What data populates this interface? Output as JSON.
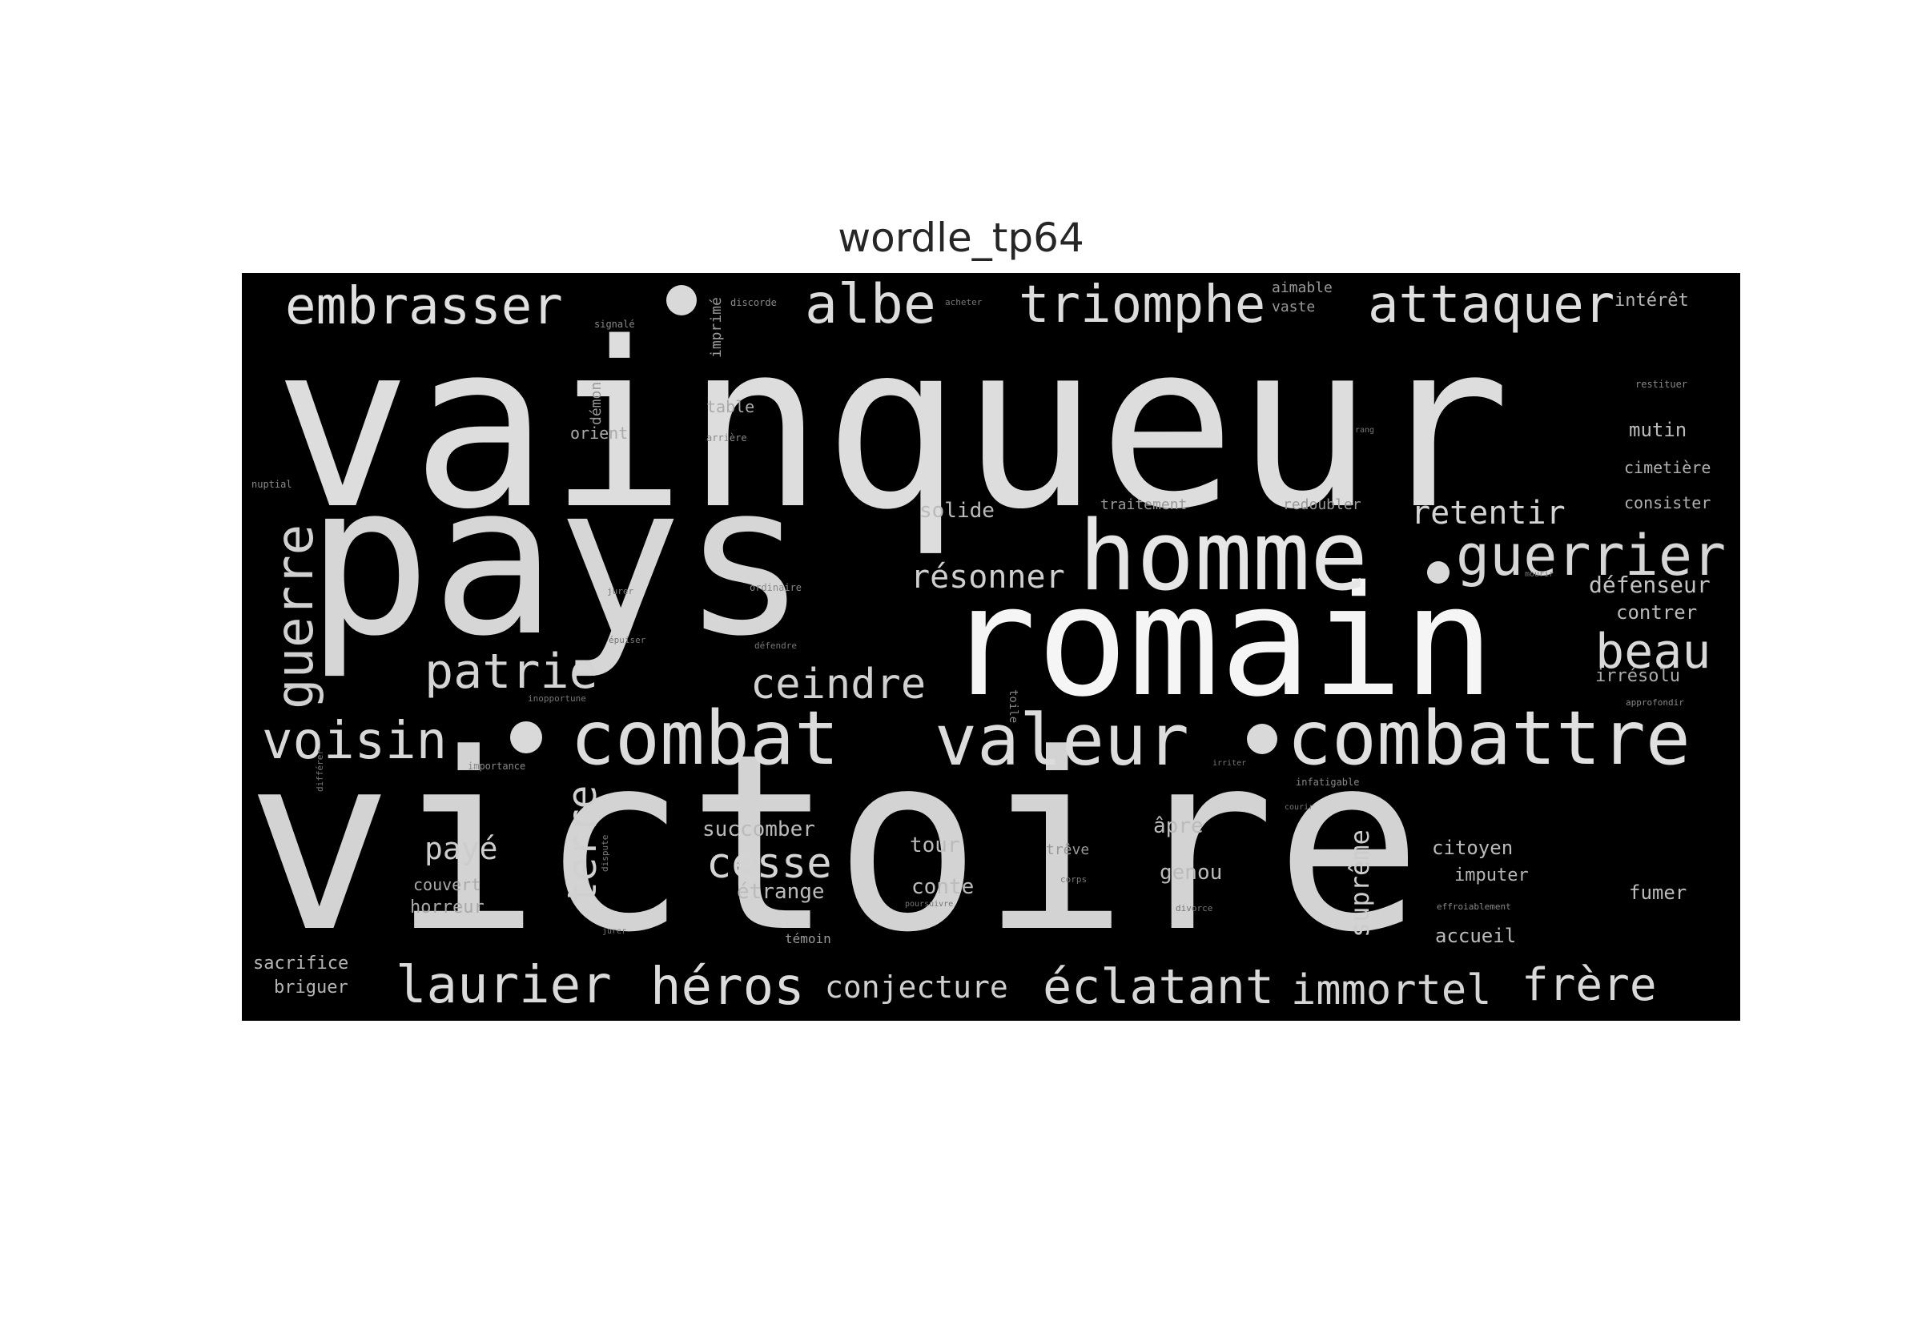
{
  "title": "wordle_tp64",
  "words": {
    "vainqueur": "vainqueur",
    "victoire": "victoire",
    "pays": "pays",
    "romain": "romain",
    "homme": "homme",
    "combattre": "combattre",
    "combat": "combat",
    "valeur": "valeur",
    "guerrier": "guerrier",
    "embrasser": "embrasser",
    "albe": "albe",
    "triomphe": "triomphe",
    "attaquer": "attaquer",
    "voisin": "voisin",
    "patrie": "patrie",
    "guerre": "guerre",
    "beau": "beau",
    "ceindre": "ceindre",
    "resonner": "résonner",
    "retentir": "retentir",
    "laurier": "laurier",
    "heros": "héros",
    "eclatant": "éclatant",
    "immortel": "immortel",
    "frere": "frère",
    "conjecture": "conjecture",
    "cesse": "cesse",
    "terre": "terre",
    "paye": "payé",
    "supreme": "suprême",
    "succomber": "succomber",
    "etrange": "étrange",
    "tour": "tour",
    "conte": "conte",
    "apre": "âpre",
    "genou": "genou",
    "citoyen": "citoyen",
    "imputer": "imputer",
    "fumer": "fumer",
    "accueil": "accueil",
    "defenseur": "défenseur",
    "contre": "contrer",
    "irresolu": "irrésolu",
    "solide": "solide",
    "mutin": "mutin",
    "cimetiere": "cimetière",
    "consister": "consister",
    "interet": "intérêt",
    "aimable": "aimable",
    "vaste": "vaste",
    "sacrifice": "sacrifice",
    "briguer": "briguer",
    "couvert": "couvert",
    "horreur": "horreur",
    "table": "table",
    "orient": "orient",
    "demon": "démon",
    "imprime": "imprimé",
    "traitement": "traitement",
    "redoubler": "redoubler",
    "treve": "trêve",
    "temoin": "témoin",
    "toile": "toile",
    "signale": "signalé",
    "discorde": "discorde",
    "acheter": "acheter",
    "arriere": "arrière",
    "nuptial": "nuptial",
    "restituer": "restituer",
    "ordinaire": "ordinaire",
    "jurer": "jurer",
    "epuiser": "épuiser",
    "defendre": "défendre",
    "importance": "importance",
    "differer": "différer",
    "dispute": "dispute",
    "infatigable": "infatigable",
    "effroiablement": "effroiablement",
    "approfondir": "approfondir",
    "inopportune": "inopportune",
    "corps": "corps",
    "divorce": "divorce",
    "poursuivre": "poursuivre",
    "courir": "courir",
    "irriter": "irriter",
    "jurer2": "jurer",
    "mourir": "mourir",
    "rang": "rang"
  },
  "colors": {
    "cloud_background": "#000000",
    "word_color": "#d9d9d9",
    "page_background": "#ffffff"
  }
}
